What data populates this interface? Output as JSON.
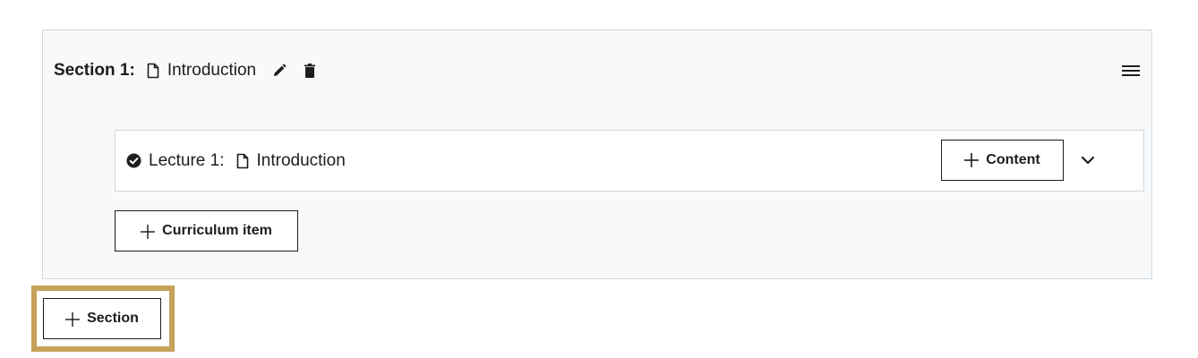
{
  "section": {
    "prefix": "Section 1:",
    "title": "Introduction",
    "icons": {
      "type": "file-icon",
      "edit": "pencil-icon",
      "delete": "trash-icon",
      "drag": "hamburger-menu-icon"
    }
  },
  "lecture": {
    "prefix": "Lecture 1:",
    "title": "Introduction",
    "status_icon": "check-circle-icon",
    "type_icon": "file-icon",
    "content_button": "Content",
    "expand_icon": "chevron-down-icon"
  },
  "buttons": {
    "curriculum_item": "Curriculum item",
    "section": "Section"
  },
  "colors": {
    "card_bg": "#f7f9fa",
    "border": "#d1d7dc",
    "text": "#1c1d1f",
    "highlight": "#c5a15a"
  }
}
